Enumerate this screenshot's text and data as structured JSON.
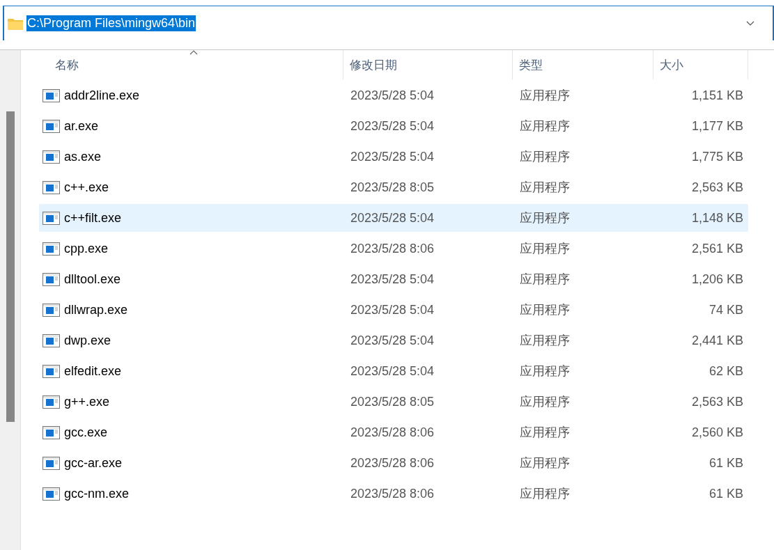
{
  "address_bar": {
    "value": "C:\\Program Files\\mingw64\\bin",
    "text_selected": true
  },
  "columns": [
    {
      "label": "名称",
      "sorted": true
    },
    {
      "label": "修改日期",
      "sorted": false
    },
    {
      "label": "类型",
      "sorted": false
    },
    {
      "label": "大小",
      "sorted": false
    }
  ],
  "files": [
    {
      "name": "addr2line.exe",
      "modified": "2023/5/28 5:04",
      "type": "应用程序",
      "size": "1,151 KB",
      "selected": false
    },
    {
      "name": "ar.exe",
      "modified": "2023/5/28 5:04",
      "type": "应用程序",
      "size": "1,177 KB",
      "selected": false
    },
    {
      "name": "as.exe",
      "modified": "2023/5/28 5:04",
      "type": "应用程序",
      "size": "1,775 KB",
      "selected": false
    },
    {
      "name": "c++.exe",
      "modified": "2023/5/28 8:05",
      "type": "应用程序",
      "size": "2,563 KB",
      "selected": false
    },
    {
      "name": "c++filt.exe",
      "modified": "2023/5/28 5:04",
      "type": "应用程序",
      "size": "1,148 KB",
      "selected": true
    },
    {
      "name": "cpp.exe",
      "modified": "2023/5/28 8:06",
      "type": "应用程序",
      "size": "2,561 KB",
      "selected": false
    },
    {
      "name": "dlltool.exe",
      "modified": "2023/5/28 5:04",
      "type": "应用程序",
      "size": "1,206 KB",
      "selected": false
    },
    {
      "name": "dllwrap.exe",
      "modified": "2023/5/28 5:04",
      "type": "应用程序",
      "size": "74 KB",
      "selected": false
    },
    {
      "name": "dwp.exe",
      "modified": "2023/5/28 5:04",
      "type": "应用程序",
      "size": "2,441 KB",
      "selected": false
    },
    {
      "name": "elfedit.exe",
      "modified": "2023/5/28 5:04",
      "type": "应用程序",
      "size": "62 KB",
      "selected": false
    },
    {
      "name": "g++.exe",
      "modified": "2023/5/28 8:05",
      "type": "应用程序",
      "size": "2,563 KB",
      "selected": false
    },
    {
      "name": "gcc.exe",
      "modified": "2023/5/28 8:06",
      "type": "应用程序",
      "size": "2,560 KB",
      "selected": false
    },
    {
      "name": "gcc-ar.exe",
      "modified": "2023/5/28 8:06",
      "type": "应用程序",
      "size": "61 KB",
      "selected": false
    },
    {
      "name": "gcc-nm.exe",
      "modified": "2023/5/28 8:06",
      "type": "应用程序",
      "size": "61 KB",
      "selected": false
    }
  ]
}
